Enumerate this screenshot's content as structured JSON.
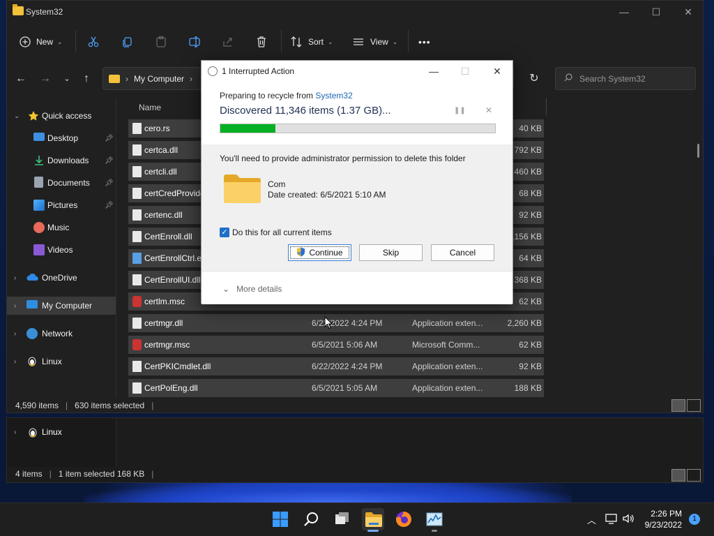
{
  "window": {
    "title": "System32",
    "controls": {
      "minimize": "—",
      "maximize": "☐",
      "close": "✕"
    }
  },
  "toolbar": {
    "new_label": "New",
    "sort_label": "Sort",
    "view_label": "View",
    "more": "•••"
  },
  "address": {
    "breadcrumb": "My Computer",
    "separator": "›",
    "search_placeholder": "Search System32"
  },
  "sidebar": {
    "items": [
      {
        "label": "Quick access"
      },
      {
        "label": "Desktop"
      },
      {
        "label": "Downloads"
      },
      {
        "label": "Documents"
      },
      {
        "label": "Pictures"
      },
      {
        "label": "Music"
      },
      {
        "label": "Videos"
      },
      {
        "label": "OneDrive"
      },
      {
        "label": "My Computer"
      },
      {
        "label": "Network"
      },
      {
        "label": "Linux"
      }
    ]
  },
  "columns": {
    "name": "Name"
  },
  "files": [
    {
      "name": "cero.rs",
      "date": "",
      "type": "",
      "size": "40 KB"
    },
    {
      "name": "certca.dll",
      "date": "",
      "type": "",
      "size": "792 KB"
    },
    {
      "name": "certcli.dll",
      "date": "",
      "type": "",
      "size": "460 KB"
    },
    {
      "name": "certCredProvide",
      "date": "",
      "type": "",
      "size": "68 KB"
    },
    {
      "name": "certenc.dll",
      "date": "",
      "type": "",
      "size": "92 KB"
    },
    {
      "name": "CertEnroll.dll",
      "date": "",
      "type": "",
      "size": ",156 KB"
    },
    {
      "name": "CertEnrollCtrl.ex",
      "date": "",
      "type": "",
      "size": "64 KB"
    },
    {
      "name": "CertEnrollUI.dll",
      "date": "",
      "type": "",
      "size": "368 KB"
    },
    {
      "name": "certlm.msc",
      "date": "",
      "type": "",
      "size": "62 KB"
    },
    {
      "name": "certmgr.dll",
      "date": "6/22/2022 4:24 PM",
      "type": "Application exten...",
      "size": "2,260 KB"
    },
    {
      "name": "certmgr.msc",
      "date": "6/5/2021 5:06 AM",
      "type": "Microsoft Comm...",
      "size": "62 KB"
    },
    {
      "name": "CertPKICmdlet.dll",
      "date": "6/22/2022 4:24 PM",
      "type": "Application exten...",
      "size": "92 KB"
    },
    {
      "name": "CertPolEng.dll",
      "date": "6/5/2021 5:05 AM",
      "type": "Application exten...",
      "size": "188 KB"
    }
  ],
  "status": {
    "items": "4,590 items",
    "selected": "630 items selected"
  },
  "bg_window": {
    "nav_label": "Linux",
    "items": "4 items",
    "selected": "1 item selected  168 KB"
  },
  "dialog": {
    "title": "1 Interrupted Action",
    "preparing": "Preparing to recycle from ",
    "source_link": "System32",
    "discovered": "Discovered 11,346 items (1.37 GB)...",
    "progress_fraction": 0.2,
    "message": "You'll need to provide administrator permission to delete this folder",
    "folder_name": "Com",
    "folder_date": "Date created: 6/5/2021 5:10 AM",
    "checkbox_label": "Do this for all current items",
    "checkbox_checked": true,
    "continue_label": "Continue",
    "skip_label": "Skip",
    "cancel_label": "Cancel",
    "more_details": "More details"
  },
  "taskbar": {
    "time": "2:26 PM",
    "date": "9/23/2022",
    "notification_count": "1"
  },
  "colors": {
    "progress_fill": "#06b025",
    "selection": "#3e3e3e",
    "accent": "#1f6fc6"
  }
}
